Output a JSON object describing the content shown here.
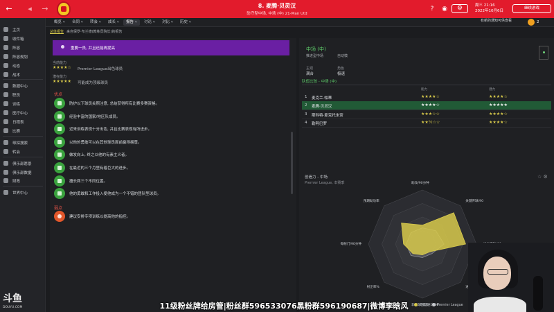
{
  "colors": {
    "topbar": "#e21b2c",
    "banner": "#6a1fa3",
    "accent_green": "#5fce6b",
    "star_gold": "#d7c94b",
    "highlight_row": "#215a36",
    "radar_player": "#d7c94b",
    "radar_league": "#c6c9ce"
  },
  "header": {
    "title": "8. 麦腾·贝灵汉",
    "subtitle": "防守型中场, 中场 (中) 21-Man Utd",
    "date_line1": "周三 21:16",
    "date_line2": "2022年10月6日",
    "continue_label": "继续游戏",
    "icons": [
      "back-icon",
      "forward-icon",
      "help-icon",
      "globe-icon",
      "gear-icon"
    ]
  },
  "sidebar": {
    "items": [
      {
        "label": "主页",
        "icon": "home-icon"
      },
      {
        "label": "收件箱",
        "icon": "inbox-icon"
      },
      {
        "label": "阵容",
        "icon": "squad-icon"
      },
      {
        "label": "阵容规划",
        "icon": "planner-icon"
      },
      {
        "label": "动态",
        "icon": "dynamics-icon"
      },
      {
        "label": "战术",
        "icon": "tactics-icon"
      },
      {
        "label": "数据中心",
        "icon": "data-icon"
      },
      {
        "label": "职员",
        "icon": "staff-icon"
      },
      {
        "label": "训练",
        "icon": "training-icon"
      },
      {
        "label": "医疗中心",
        "icon": "medical-icon"
      },
      {
        "label": "日程表",
        "icon": "schedule-icon"
      },
      {
        "label": "比赛",
        "icon": "match-icon"
      },
      {
        "label": "球探搜索",
        "icon": "scouting-icon"
      },
      {
        "label": "转会",
        "icon": "transfer-icon"
      },
      {
        "label": "俱乐部愿景",
        "icon": "vision-icon"
      },
      {
        "label": "俱乐部数据",
        "icon": "club-data-icon"
      },
      {
        "label": "财政",
        "icon": "finance-icon"
      },
      {
        "label": "世界中心",
        "icon": "world-icon"
      }
    ]
  },
  "tabs": [
    {
      "label": "概览",
      "active": false
    },
    {
      "label": "合同",
      "active": false
    },
    {
      "label": "转会",
      "active": false
    },
    {
      "label": "成长",
      "active": false
    },
    {
      "label": "报告",
      "active": true
    },
    {
      "label": "讨论",
      "active": false
    },
    {
      "label": "对比",
      "active": false
    },
    {
      "label": "历史",
      "active": false
    }
  ],
  "subtabs": [
    "总体报告",
    "来自保罗·布兰德(教练员院长)的报告"
  ],
  "right_note": "有新的通知可供查看",
  "download_count": "2",
  "left": {
    "banner_text": "重要一员, 并且还能再提高",
    "current_ability_label": "当前能力",
    "current_stars": "★★★★☆",
    "current_desc": "Premier League出色球员",
    "potential_label": "潜在能力",
    "potential_stars": "★★★★★",
    "potential_desc": "可能成为顶级球员",
    "strengths_title": "优点",
    "strengths": [
      "防护以下球员关照注意, 总结获得所有比赛多赛资格。",
      "经验丰富的国家/地区队成员。",
      "近来训练表现十分出色, 并且比赛表现有所进步。",
      "以他的勇敢可以在其他球员面前赢得拥尊。",
      "做发向上, 终之以他的有素主义者。",
      "在最近的三个月里有着巨大的进步。",
      "擅长两三个不同位置。",
      "他的勇敢和工作投入使他成为一个不错的团队型球员。"
    ],
    "weaknesses_title": "弱点",
    "weaknesses": [
      "建议安排专项训练以提高他的指控。"
    ]
  },
  "right": {
    "position_title": "中场 (中)",
    "role": "推进型中场",
    "duty": "自动模",
    "labels": {
      "suitability": "主观",
      "rating": "角色"
    },
    "values": {
      "suitability": "满合",
      "rating": "极速"
    },
    "ranking_header": "队伍比较 - 中场 (中)",
    "col_current": "能力",
    "col_potential": "潜力",
    "players": [
      {
        "num": "1",
        "name": "麦克兰·帕蒂",
        "cur": "★★★★☆",
        "pot": "★★★★☆",
        "highlight": false
      },
      {
        "num": "2",
        "name": "麦腾·贝灵汉",
        "cur": "★★★★☆",
        "pot": "★★★★★",
        "highlight": true
      },
      {
        "num": "3",
        "name": "斯科特·麦克托米奈",
        "cur": "★★★☆☆",
        "pot": "★★★★☆",
        "highlight": false
      },
      {
        "num": "4",
        "name": "勒阿巴罗",
        "cur": "★★½☆☆",
        "pot": "★★★★☆",
        "highlight": false
      }
    ],
    "radar": {
      "title": "创造力 - 中场",
      "subtitle": "Premier League, 本赛季",
      "axes": [
        "助攻/90分钟",
        "关键传球/90",
        "推进传球/90",
        "进球/90",
        "非点球预期进球/90",
        "射正率%",
        "每射门/90分钟",
        "预期助攻率"
      ],
      "player_values": [
        0.35,
        0.82,
        0.8,
        0.2,
        0.2,
        0.25,
        0.35,
        0.55
      ],
      "league_values": [
        0.3,
        0.35,
        0.4,
        0.25,
        0.25,
        0.3,
        0.3,
        0.3
      ],
      "legend_player": "贝灵汉",
      "legend_league": "Premier League"
    }
  },
  "overlay": {
    "caption": "11级粉丝牌给房管|粉丝群596533076黑粉群596190687|微博李晗风",
    "watermark": "斗鱼",
    "watermark_sub": "DOUYU.COM"
  }
}
